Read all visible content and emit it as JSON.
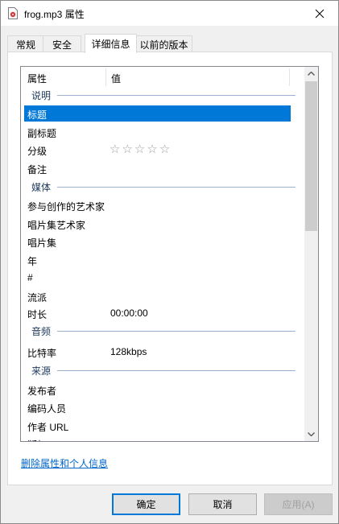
{
  "window": {
    "title": "frog.mp3 属性"
  },
  "tabs": [
    "常规",
    "安全",
    "详细信息",
    "以前的版本"
  ],
  "list": {
    "header": {
      "property": "属性",
      "value": "值"
    },
    "groups": {
      "description": {
        "label": "说明",
        "rows": [
          {
            "name": "标题",
            "value": ""
          },
          {
            "name": "副标题",
            "value": ""
          },
          {
            "name": "分级",
            "value": ""
          },
          {
            "name": "备注",
            "value": ""
          }
        ]
      },
      "media": {
        "label": "媒体",
        "rows": [
          {
            "name": "参与创作的艺术家",
            "value": ""
          },
          {
            "name": "唱片集艺术家",
            "value": ""
          },
          {
            "name": "唱片集",
            "value": ""
          },
          {
            "name": "年",
            "value": ""
          },
          {
            "name": "#",
            "value": ""
          },
          {
            "name": "流派",
            "value": ""
          },
          {
            "name": "时长",
            "value": "00:00:00"
          }
        ]
      },
      "audio": {
        "label": "音频",
        "rows": [
          {
            "name": "比特率",
            "value": "128kbps"
          }
        ]
      },
      "origin": {
        "label": "来源",
        "rows": [
          {
            "name": "发布者",
            "value": ""
          },
          {
            "name": "编码人员",
            "value": ""
          },
          {
            "name": "作者 URL",
            "value": ""
          },
          {
            "name": "版权",
            "value": ""
          }
        ]
      }
    },
    "rating_stars": "☆",
    "rating_value": 0,
    "rating_max": 5
  },
  "link_text": "删除属性和个人信息",
  "buttons": {
    "ok": "确定",
    "cancel": "取消",
    "apply": "应用(A)"
  }
}
